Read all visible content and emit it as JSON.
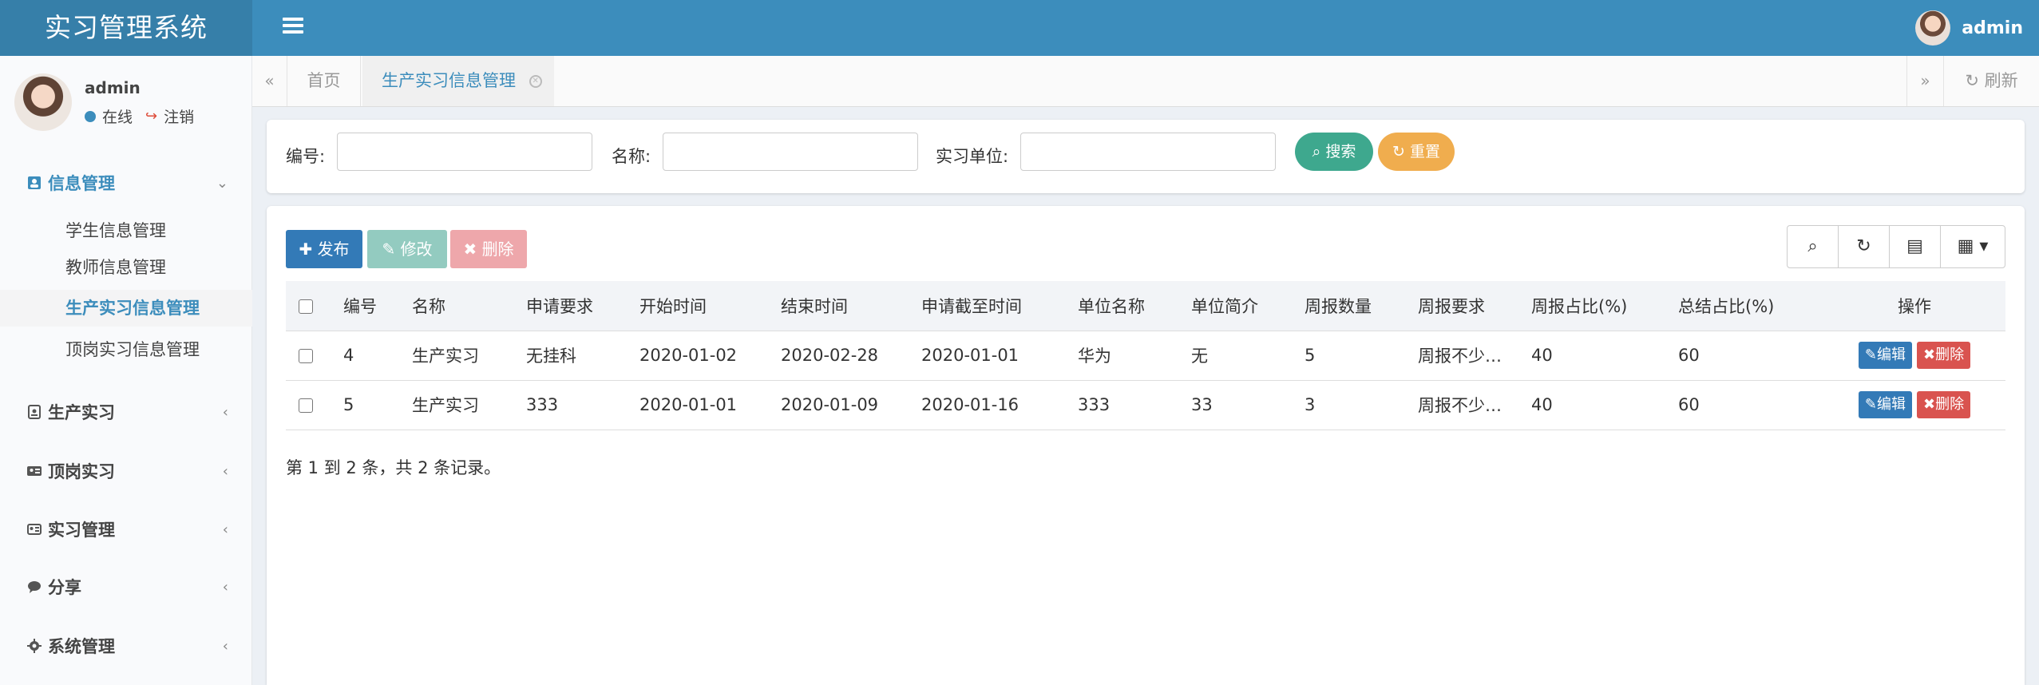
{
  "app": {
    "title": "实习管理系统",
    "top_user": "admin"
  },
  "sidebar": {
    "user": {
      "name": "admin",
      "status": "在线",
      "logout": "注销"
    },
    "groups": [
      {
        "label": "信息管理",
        "icon": "user-card-icon",
        "open": true,
        "items": [
          {
            "label": "学生信息管理"
          },
          {
            "label": "教师信息管理"
          },
          {
            "label": "生产实习信息管理",
            "active": true
          },
          {
            "label": "顶岗实习信息管理"
          }
        ]
      },
      {
        "label": "生产实习",
        "icon": "id-badge-icon"
      },
      {
        "label": "顶岗实习",
        "icon": "id-card-icon"
      },
      {
        "label": "实习管理",
        "icon": "id-card-icon"
      },
      {
        "label": "分享",
        "icon": "comment-icon"
      },
      {
        "label": "系统管理",
        "icon": "gear-icon"
      }
    ]
  },
  "tabs": {
    "home": "首页",
    "active": "生产实习信息管理",
    "refresh": "刷新"
  },
  "search": {
    "fields": [
      {
        "label": "编号:",
        "placeholder": ""
      },
      {
        "label": "名称:",
        "placeholder": ""
      },
      {
        "label": "实习单位:",
        "placeholder": ""
      }
    ],
    "search_label": "搜索",
    "reset_label": "重置"
  },
  "toolbar": {
    "add_label": "发布",
    "edit_label": "修改",
    "delete_label": "删除"
  },
  "table": {
    "columns": [
      "编号",
      "名称",
      "申请要求",
      "开始时间",
      "结束时间",
      "申请截至时间",
      "单位名称",
      "单位简介",
      "周报数量",
      "周报要求",
      "周报占比(%)",
      "总结占比(%)",
      "操作"
    ],
    "rows": [
      [
        "4",
        "生产实习",
        "无挂科",
        "2020-01-02",
        "2020-02-28",
        "2020-01-01",
        "华为",
        "无",
        "5",
        "周报不少…",
        "40",
        "60"
      ],
      [
        "5",
        "生产实习",
        "333",
        "2020-01-01",
        "2020-01-09",
        "2020-01-16",
        "333",
        "33",
        "3",
        "周报不少…",
        "40",
        "60"
      ]
    ],
    "row_edit_label": "编辑",
    "row_delete_label": "删除",
    "footer": "第 1 到 2 条，共 2 条记录。"
  },
  "colors": {
    "header": "#3c8dbc",
    "logo": "#367fa9",
    "primary": "#337ab7",
    "success": "#3ea88e",
    "warning": "#f0ad4e",
    "danger": "#d9534f"
  }
}
